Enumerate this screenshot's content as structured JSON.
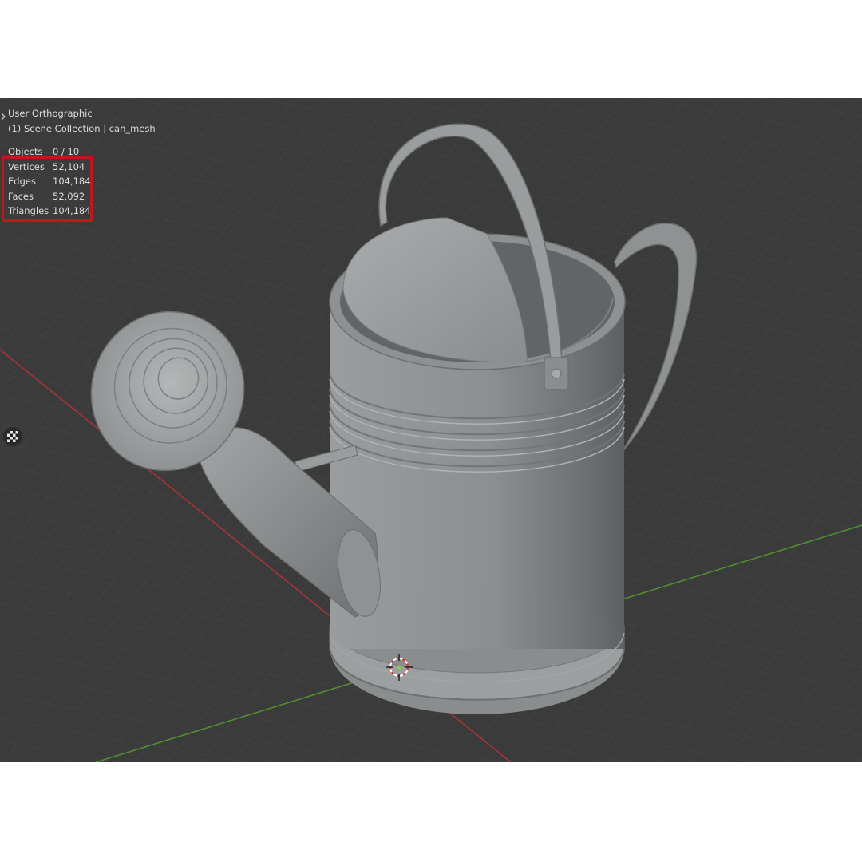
{
  "viewport": {
    "view_name": "User Orthographic",
    "collection_label": "(1) Scene Collection | can_mesh",
    "stats": [
      {
        "label": "Objects",
        "value": "0 / 10"
      },
      {
        "label": "Vertices",
        "value": "52,104"
      },
      {
        "label": "Edges",
        "value": "104,184"
      },
      {
        "label": "Faces",
        "value": "52,092"
      },
      {
        "label": "Triangles",
        "value": "104,184"
      }
    ],
    "highlight_color": "#c0161c",
    "background_color": "#3b3b3b",
    "x_axis_color": "#a8343a",
    "y_axis_color": "#4f8f2f"
  },
  "icons": {
    "expand": "chevron-right-icon",
    "gizmo": "checker-toggle-icon",
    "cursor": "3d-cursor-icon"
  },
  "scene_object": "watering-can-mesh"
}
